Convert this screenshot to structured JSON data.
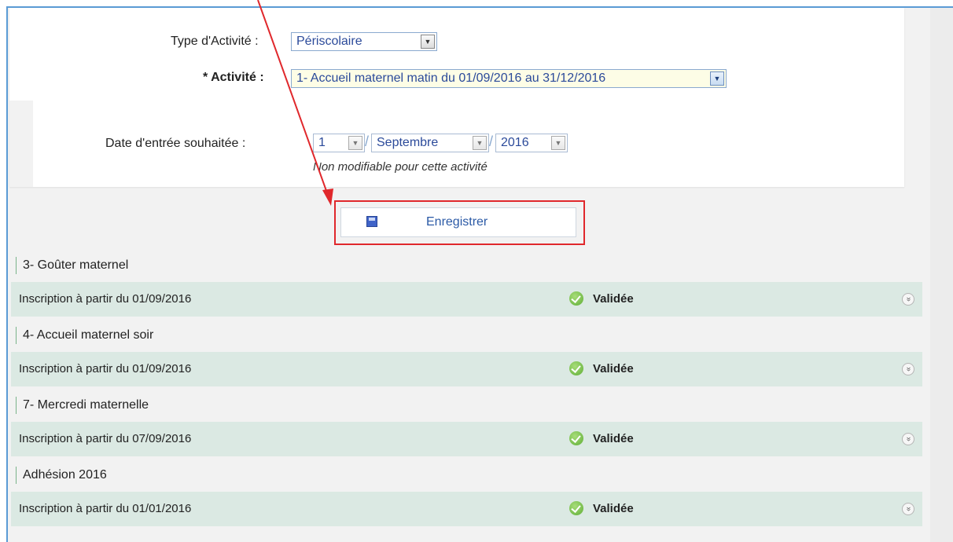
{
  "form": {
    "type_label": "Type d'Activité :",
    "type_value": "Périscolaire",
    "activity_label": "* Activité :",
    "activity_value": "1- Accueil maternel matin du 01/09/2016 au 31/12/2016",
    "date_label": "Date d'entrée souhaitée :",
    "date_day": "1",
    "date_month": "Septembre",
    "date_year": "2016",
    "date_note": "Non modifiable pour cette activité"
  },
  "actions": {
    "save_label": "Enregistrer"
  },
  "groups": [
    {
      "title": "3- Goûter maternel",
      "from": "Inscription à partir du 01/09/2016",
      "status": "Validée"
    },
    {
      "title": "4- Accueil maternel soir",
      "from": "Inscription à partir du 01/09/2016",
      "status": "Validée"
    },
    {
      "title": "7- Mercredi maternelle",
      "from": "Inscription à partir du 07/09/2016",
      "status": "Validée"
    },
    {
      "title": "Adhésion 2016",
      "from": "Inscription à partir du 01/01/2016",
      "status": "Validée"
    }
  ],
  "colors": {
    "annotation": "#e0282c",
    "row_bg": "#dbe9e3",
    "link_text": "#2b5aa6"
  },
  "icons": {
    "save": "floppy-disk-icon",
    "status": "check-circle-icon",
    "expand": "double-chevron-down-icon",
    "dropdown": "triangle-down-icon"
  }
}
